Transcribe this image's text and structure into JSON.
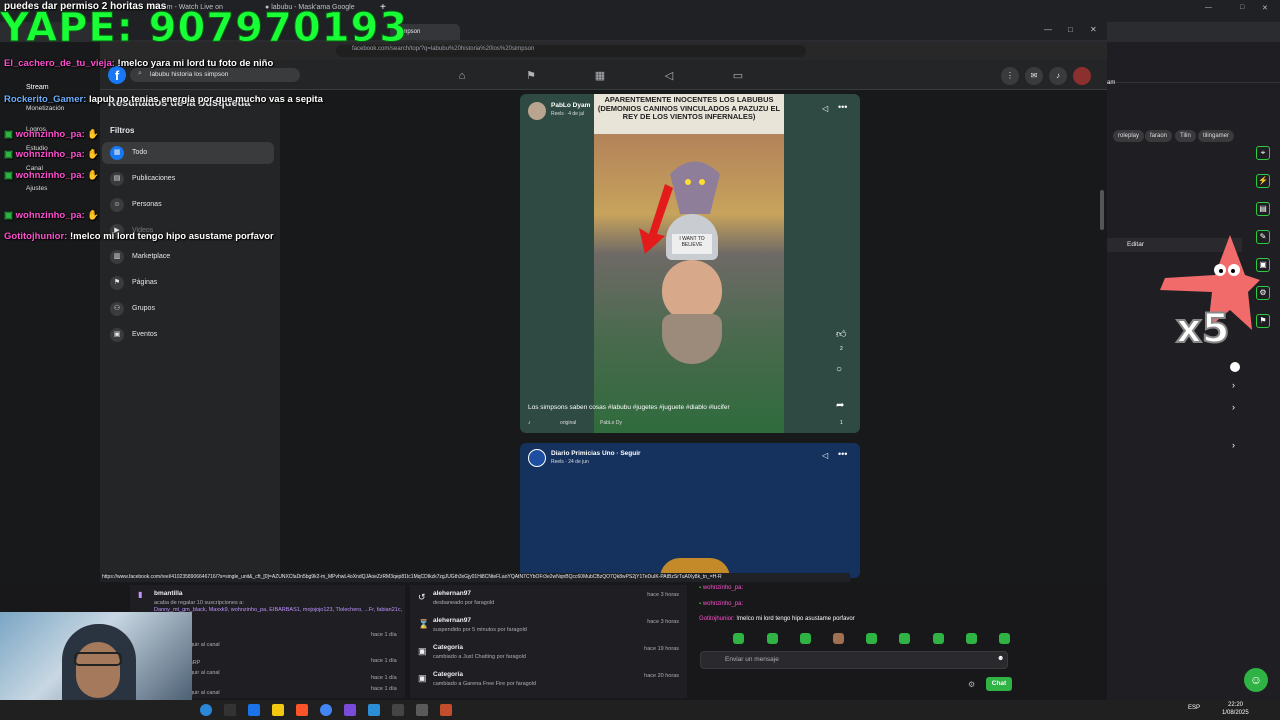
{
  "overlay": {
    "top_message": "puedes dar permiso 2 horitas mas",
    "yape": "YAPE: 907970193",
    "chat_lines": [
      {
        "user": "El_cachero_de_tu_vieja:",
        "msg": " !melco yara mi lord tu foto de niño"
      },
      {
        "user": "Rockerito_Gamer:",
        "msg": " lapub no tenias energia por que mucho vas a sepita"
      },
      {
        "user": "wohnzinho_pa:",
        "msg": ""
      },
      {
        "user": "wohnzinho_pa:",
        "msg": ""
      },
      {
        "user": "wohnzinho_pa:",
        "msg": ""
      },
      {
        "user": "wohnzinho_pa:",
        "msg": ""
      },
      {
        "user": "Gotitojhunior:",
        "msg": " !melco mi lord tengo hipo asustame porfavor"
      }
    ],
    "x5": "x5"
  },
  "outer_tabs": [
    "Stream - Watch Live on",
    "labubu - Mask'ama Google"
  ],
  "browser": {
    "url": "facebook.com/search/top/?q=labubu%20historia%20los%20simpson",
    "status_url": "https://www.facebook.com/reel/4102358906646716/?s=single_unit&_cft_[0]=AZUNXCfaDn5bg9k2-m_MPvhwL4oXndQJAoeZzRM3qep81Ic1MqCDIkzk7zgJUGth3xGjy01Hi8CNteFLaoYQAtN7CYbOFr3e2wNqnBQcc60MubCBzQO7Qk8wPS2jY1TeDuIK-PAtBzSrTuAlXy8k_tn_=H-R"
  },
  "facebook": {
    "search_value": "labubu historia los simpson",
    "results_heading": "Resultados de la búsqueda",
    "filters_label": "Filtros",
    "nav": [
      {
        "label": "Todo",
        "icon": "grid-icon"
      },
      {
        "label": "Publicaciones",
        "icon": "posts-icon"
      },
      {
        "label": "Personas",
        "icon": "people-icon"
      },
      {
        "label": "Videos",
        "icon": "video-icon"
      },
      {
        "label": "Marketplace",
        "icon": "store-icon"
      },
      {
        "label": "Páginas",
        "icon": "flag-icon"
      },
      {
        "label": "Grupos",
        "icon": "groups-icon"
      },
      {
        "label": "Eventos",
        "icon": "calendar-icon"
      }
    ],
    "post1": {
      "author": "PabLo Dyam",
      "meta": "Reels · 4 de jul",
      "caption_top": "APARENTEMENTE INOCENTES LOS LABUBUS (DEMONIOS CANINOS VINCULADOS A PAZUZU EL REY DE LOS VIENTOS INFERNALES)",
      "hat_text": "I WANT TO BELIEVE",
      "description": "Los simpsons saben cosas #labubu #jugetes #juguete #diablo #lucifer",
      "audio": "original",
      "audio_author": "PabLo Dy",
      "like_count": "2",
      "share_count": "1"
    },
    "post2": {
      "author": "Diario Primicias Uno · Seguir",
      "meta": "Reels · 24 de jun"
    }
  },
  "stream_dash": {
    "menu": [
      "Stream",
      "Monetización",
      "Logros",
      "Estudio",
      "Canal",
      "Ajustes"
    ],
    "tags": [
      "roleplay",
      "faraon",
      "Tilin",
      "tilingamer"
    ],
    "edit_label": "Editar"
  },
  "activity": {
    "sub_user": "bmantilla",
    "sub_text": "acaba de regalar 10 suscripciones a:",
    "sub_list": "Danny_mt_gm_black, Maxxk9, wohnzinho_pa, EIBARBAS1, mojojojo123, Tlolechero, ...Fr, fabian21c, elcutiembre",
    "left_times": [
      "hace 1 día",
      "hace 1 día",
      "hace 1 día",
      "hace 1 día"
    ],
    "left_lines": [
      "guir al canal",
      "sRP",
      "guir al canal",
      "guir al canal"
    ],
    "rows": [
      {
        "title": "alehernan97",
        "sub": "desbaneado por faragold",
        "time": "hace 3 horas",
        "icon": "undo-icon"
      },
      {
        "title": "alehernan97",
        "sub": "suspendido por 5 minutos por faragold",
        "time": "hace 3 horas",
        "icon": "timer-icon"
      },
      {
        "title": "Categoría",
        "sub": "cambiado a Just Chatting por faragold",
        "time": "hace 19 horas",
        "icon": "category-icon"
      },
      {
        "title": "Categoría",
        "sub": "cambiado a Garena Free Fire por faragold",
        "time": "hace 20 horas",
        "icon": "category-icon"
      }
    ]
  },
  "chat_panel": {
    "lines": [
      {
        "user": "wohnzinho_pa:",
        "msg": ""
      },
      {
        "user": "wohnzinho_pa:",
        "msg": ""
      },
      {
        "user": "Gotitojhunior:",
        "msg": " !melco mi lord tengo hipo asustame porfavor"
      }
    ],
    "input_placeholder": "Enviar un mensaje",
    "send_label": "Chat"
  },
  "taskbar": {
    "lang": "ESP",
    "time": "22:20",
    "date": "1/08/2025"
  }
}
